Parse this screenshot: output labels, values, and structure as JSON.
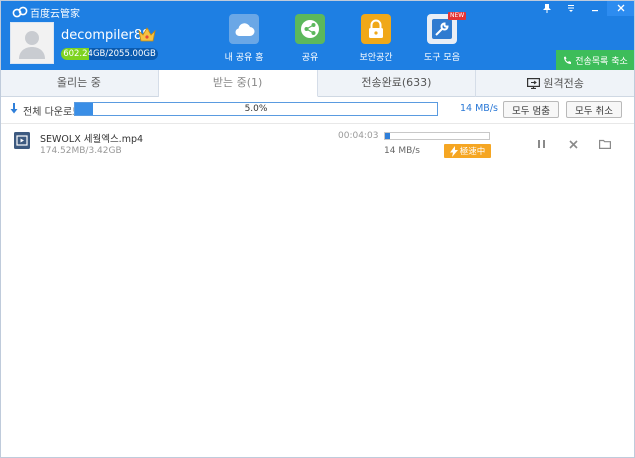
{
  "app": {
    "title": "百度云管家"
  },
  "window": {
    "controls": [
      "pin-icon",
      "menu-icon",
      "minimize-icon",
      "close-icon"
    ]
  },
  "user": {
    "name": "decompiler88",
    "quota_text": "602.24GB/2055.00GB",
    "quota_used_fraction": 0.293
  },
  "nav": {
    "items": [
      {
        "label": "내 공유 홈",
        "icon": "cloud-icon",
        "color": "#6aa7e6"
      },
      {
        "label": "공유",
        "icon": "share-icon",
        "color": "#5cb85c"
      },
      {
        "label": "보안공간",
        "icon": "lock-icon",
        "color": "#f0a818"
      },
      {
        "label": "도구 모음",
        "icon": "tools-icon",
        "color": "#2f7bd0",
        "badge": "NEW"
      }
    ]
  },
  "transfer_list_button": "전송목록 축소",
  "tabs": [
    {
      "label": "올리는 중"
    },
    {
      "label": "받는 중(1)",
      "active": true
    },
    {
      "label": "전송완료(633)"
    },
    {
      "label": "원격전송"
    }
  ],
  "overall": {
    "label": "전체 다운로드",
    "percent_text": "5.0%",
    "progress_fraction": 0.05,
    "speed": "14 MB/s",
    "pause_all": "모두 멈춤",
    "cancel_all": "모두 취소"
  },
  "downloads": [
    {
      "name": "SEWOLX 세월엑스.mp4",
      "size": "174.52MB/3.42GB",
      "time": "00:04:03",
      "speed": "14 MB/s",
      "progress_fraction": 0.05,
      "accel_label": "極速中"
    }
  ],
  "colors": {
    "header": "#1e7fe3",
    "accent": "#2f7fd9",
    "green": "#3dbd5a",
    "orange": "#f5a623"
  }
}
